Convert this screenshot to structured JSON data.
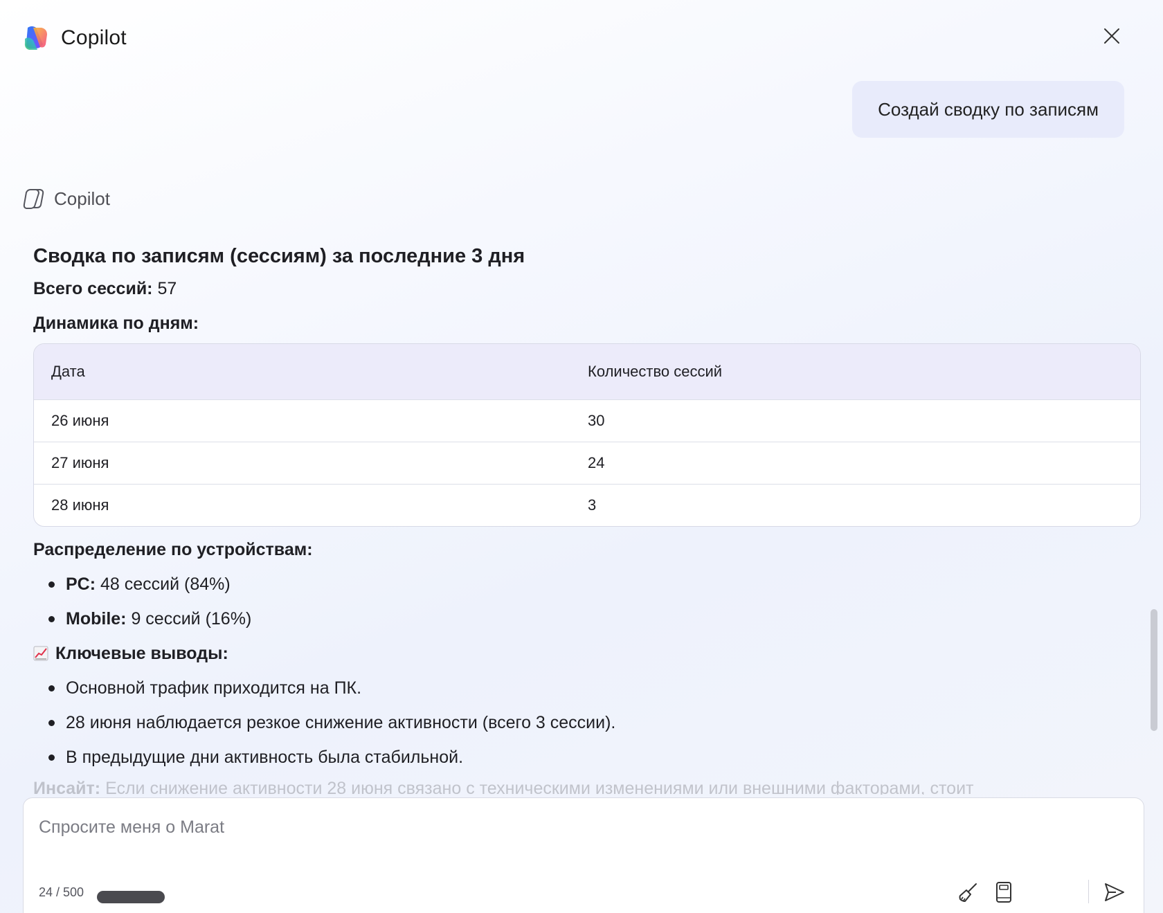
{
  "header": {
    "title": "Copilot",
    "close_icon": "close-icon",
    "logo_icon": "copilot-logo-icon"
  },
  "user_message": {
    "text": "Создай сводку по записям"
  },
  "assistant": {
    "name": "Copilot",
    "icon": "copilot-outline-icon",
    "title": "Сводка по записям (сессиям) за последние 3 дня",
    "total_label": "Всего сессий:",
    "total_value": "57",
    "dynamics_title": "Динамика по дням:",
    "table": {
      "headers": [
        "Дата",
        "Количество сессий"
      ],
      "rows": [
        [
          "26 июня",
          "30"
        ],
        [
          "27 июня",
          "24"
        ],
        [
          "28 июня",
          "3"
        ]
      ]
    },
    "devices_title": "Распределение по устройствам:",
    "devices": [
      {
        "label": "PC:",
        "text": "48 сессий (84%)"
      },
      {
        "label": "Mobile:",
        "text": "9 сессий (16%)"
      }
    ],
    "insights_icon": "chart-increasing-icon",
    "insights_title": "Ключевые выводы:",
    "insights": [
      "Основной трафик приходится на ПК.",
      "28 июня наблюдается резкое снижение активности (всего 3 сессии).",
      "В предыдущие дни активность была стабильной."
    ],
    "insight_label": "Инсайт:",
    "insight_text": "Если снижение активности 28 июня связано с техническими изменениями или внешними факторами, стоит"
  },
  "composer": {
    "placeholder": "Спросите меня о Marat",
    "counter": "24 / 500",
    "tools": [
      "broom-icon",
      "notebook-icon",
      "send-icon"
    ]
  }
}
